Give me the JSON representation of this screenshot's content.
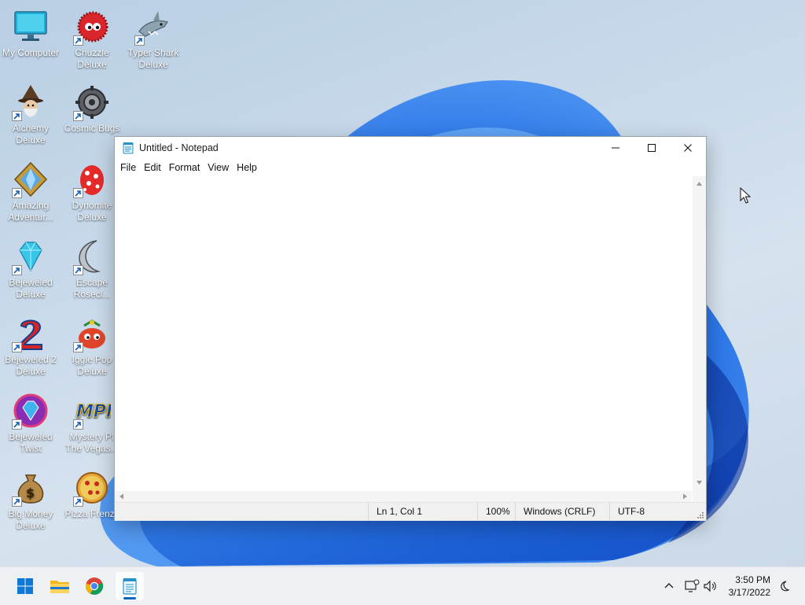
{
  "desktop": {
    "icons": [
      {
        "label": "My Computer",
        "icon": "monitor-icon"
      },
      {
        "label": "Chuzzle Deluxe",
        "icon": "chuzzle-icon"
      },
      {
        "label": "Typer Shark Deluxe",
        "icon": "shark-icon"
      },
      {
        "label": "Alchemy Deluxe",
        "icon": "wizard-icon"
      },
      {
        "label": "Cosmic Bugs",
        "icon": "gear-icon"
      },
      {
        "label": "Amazing Adventur...",
        "icon": "gem-badge-icon"
      },
      {
        "label": "Dynomite Deluxe",
        "icon": "egg-icon"
      },
      {
        "label": "Bejeweled Deluxe",
        "icon": "diamond-icon"
      },
      {
        "label": "Escape Rosecl...",
        "icon": "moon-icon"
      },
      {
        "label": "Bejeweled 2 Deluxe",
        "icon": "number-two-icon"
      },
      {
        "label": "Iggle Pop Deluxe",
        "icon": "iggle-icon"
      },
      {
        "label": "Bejeweled Twist",
        "icon": "twist-gem-icon"
      },
      {
        "label": "Mystery PI The Vegas...",
        "icon": "mpi-logo-icon"
      },
      {
        "label": "Big Money Deluxe",
        "icon": "money-bag-icon"
      },
      {
        "label": "Pizza Frenzy",
        "icon": "pizza-icon"
      }
    ]
  },
  "notepad": {
    "title": "Untitled - Notepad",
    "menu": [
      "File",
      "Edit",
      "Format",
      "View",
      "Help"
    ],
    "content": "",
    "status": {
      "position": "Ln 1, Col 1",
      "zoom": "100%",
      "line_ending": "Windows (CRLF)",
      "encoding": "UTF-8"
    }
  },
  "taskbar": {
    "items": [
      "start-icon",
      "file-explorer-icon",
      "chrome-icon",
      "notepad-icon"
    ],
    "tray": {
      "time": "3:50 PM",
      "date": "3/17/2022"
    }
  },
  "colors": {
    "accent": "#0067c0",
    "wallpaper_blue": "#1f6fe0"
  }
}
